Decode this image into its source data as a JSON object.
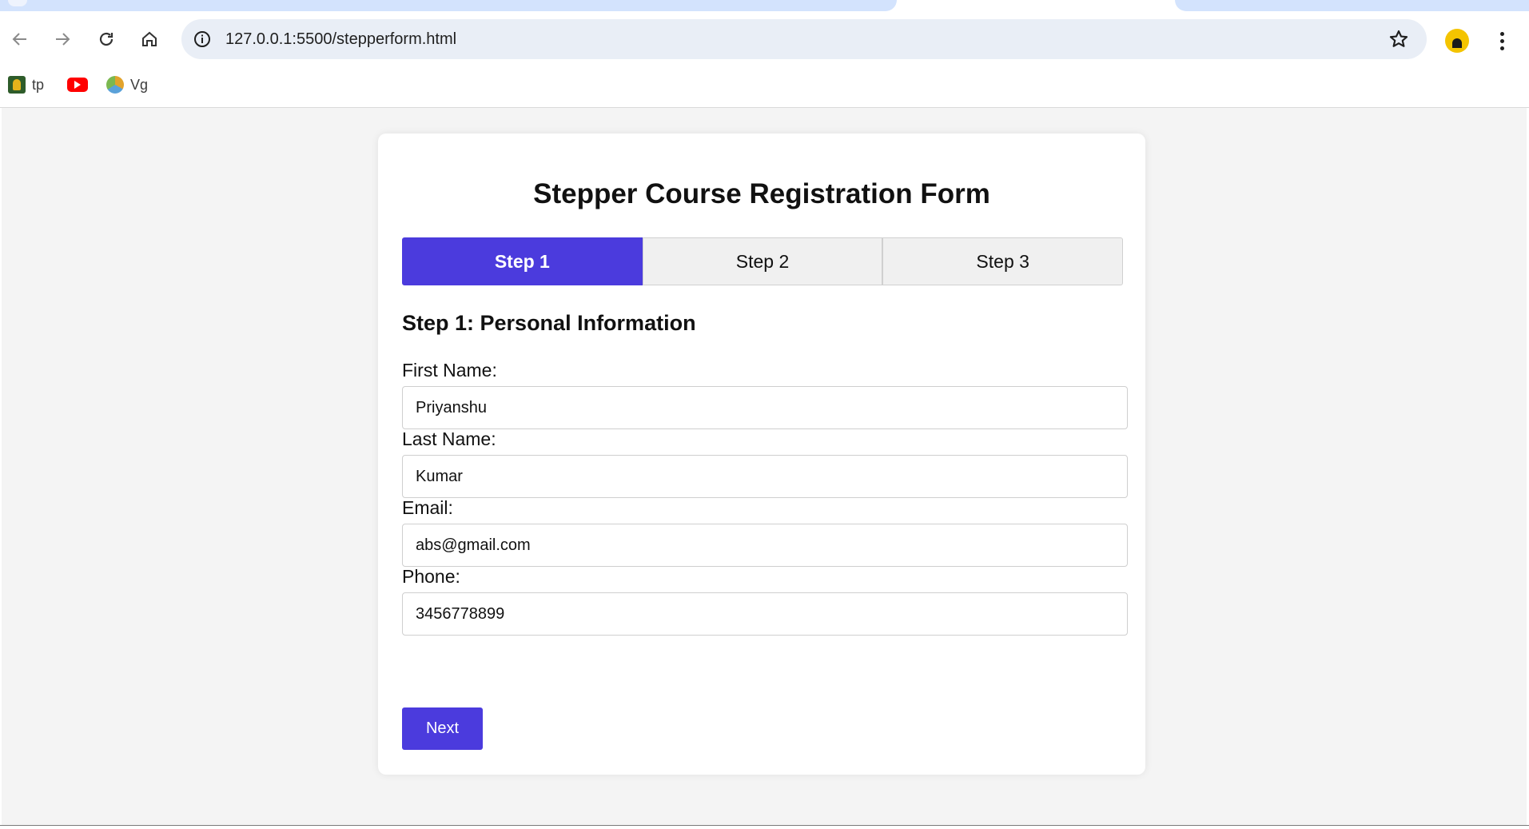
{
  "browser": {
    "url": "127.0.0.1:5500/stepperform.html",
    "bookmarks": [
      {
        "label": "tp",
        "icon": "tp-favicon"
      },
      {
        "label": "",
        "icon": "youtube-icon"
      },
      {
        "label": "Vg",
        "icon": "vg-favicon"
      }
    ]
  },
  "form": {
    "title": "Stepper Course Registration Form",
    "steps": [
      {
        "label": "Step 1",
        "active": true
      },
      {
        "label": "Step 2",
        "active": false
      },
      {
        "label": "Step 3",
        "active": false
      }
    ],
    "section_title": "Step 1: Personal Information",
    "fields": {
      "first_name": {
        "label": "First Name:",
        "value": "Priyanshu"
      },
      "last_name": {
        "label": "Last Name:",
        "value": "Kumar"
      },
      "email": {
        "label": "Email:",
        "value": "abs@gmail.com"
      },
      "phone": {
        "label": "Phone:",
        "value": "3456778899"
      }
    },
    "next_label": "Next"
  },
  "colors": {
    "accent": "#4b3bdd",
    "page_bg": "#f4f4f4",
    "omnibox_bg": "#e9eef6"
  }
}
